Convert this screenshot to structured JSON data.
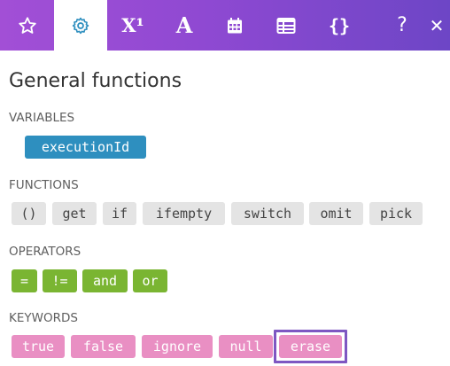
{
  "toolbar": {
    "tabs": [
      {
        "icon": "star-icon"
      },
      {
        "icon": "gear-icon",
        "active": true
      },
      {
        "icon": "superscript-icon",
        "label": "X¹"
      },
      {
        "icon": "text-icon",
        "label": "A"
      },
      {
        "icon": "calendar-icon"
      },
      {
        "icon": "table-icon"
      },
      {
        "icon": "braces-icon",
        "label": "{}"
      },
      {
        "icon": "help-icon",
        "label": "?"
      },
      {
        "icon": "close-icon",
        "label": "✕"
      }
    ],
    "colors": {
      "gradient_start": "#a24fd6",
      "gradient_end": "#6d46c6"
    }
  },
  "panel": {
    "title": "General functions",
    "sections": {
      "variables": {
        "label": "VARIABLES",
        "items": [
          "executionId"
        ]
      },
      "functions": {
        "label": "FUNCTIONS",
        "items": [
          "()",
          "get",
          "if",
          "ifempty",
          "switch",
          "omit",
          "pick"
        ]
      },
      "operators": {
        "label": "OPERATORS",
        "items": [
          "=",
          "!=",
          "and",
          "or"
        ]
      },
      "keywords": {
        "label": "KEYWORDS",
        "items": [
          "true",
          "false",
          "ignore",
          "null",
          "erase"
        ],
        "selected": "erase"
      }
    },
    "colors": {
      "variable": "#2e8fbf",
      "function": "#e4e4e4",
      "operator": "#7ab532",
      "keyword": "#e98fc3",
      "selection": "#7e57c2"
    }
  }
}
